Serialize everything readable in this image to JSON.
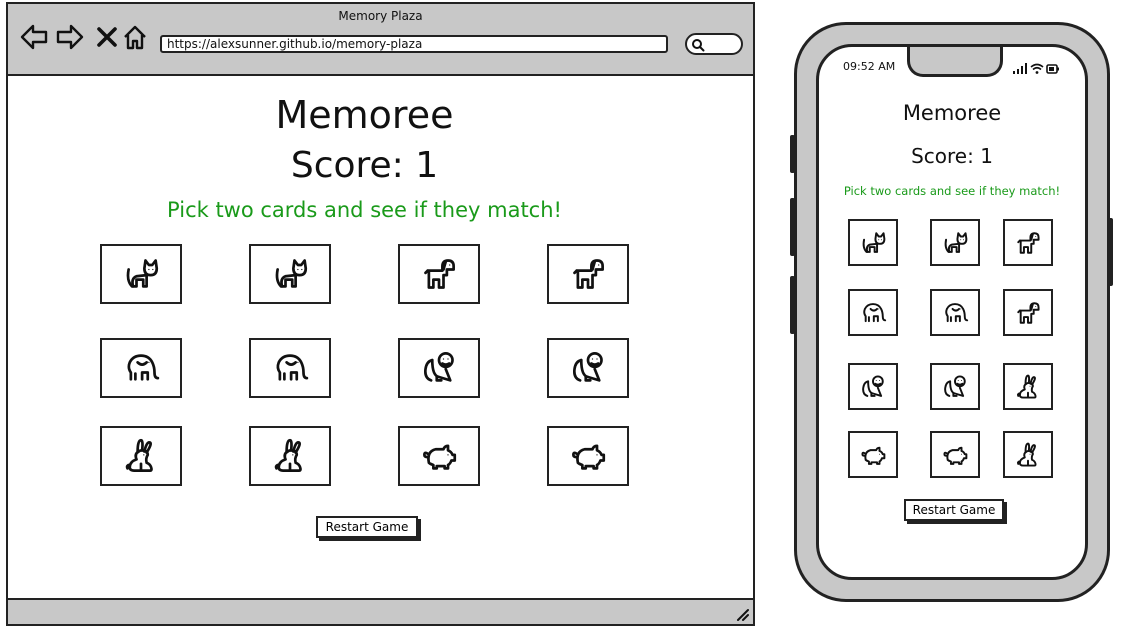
{
  "browser": {
    "window_title": "Memory Plaza",
    "url": "https://alexsunner.github.io/memory-plaza",
    "nav_icons": [
      "back-arrow-icon",
      "forward-arrow-icon",
      "close-x-icon",
      "home-icon"
    ],
    "search_icon": "magnifier-icon"
  },
  "game": {
    "title": "Memoree",
    "score_text": "Score: 1",
    "message": "Pick two cards and see if they match!",
    "restart_label": "Restart Game",
    "message_color": "#1a9a1a"
  },
  "desktop_cards": [
    "cat",
    "cat",
    "dog",
    "dog",
    "elephant",
    "elephant",
    "monkey",
    "monkey",
    "rabbit",
    "rabbit",
    "pig",
    "pig"
  ],
  "mobile": {
    "time": "09:52 AM",
    "status_icons": [
      "signal-icon",
      "wifi-icon",
      "battery-icon"
    ],
    "cards": [
      "cat",
      "cat",
      "dog",
      "elephant",
      "elephant",
      "dog",
      "monkey",
      "monkey",
      "rabbit",
      "pig",
      "pig",
      "rabbit"
    ]
  },
  "colors": {
    "chrome_gray": "#c8c8c8",
    "outline": "#222222",
    "message_green": "#1a9a1a"
  }
}
